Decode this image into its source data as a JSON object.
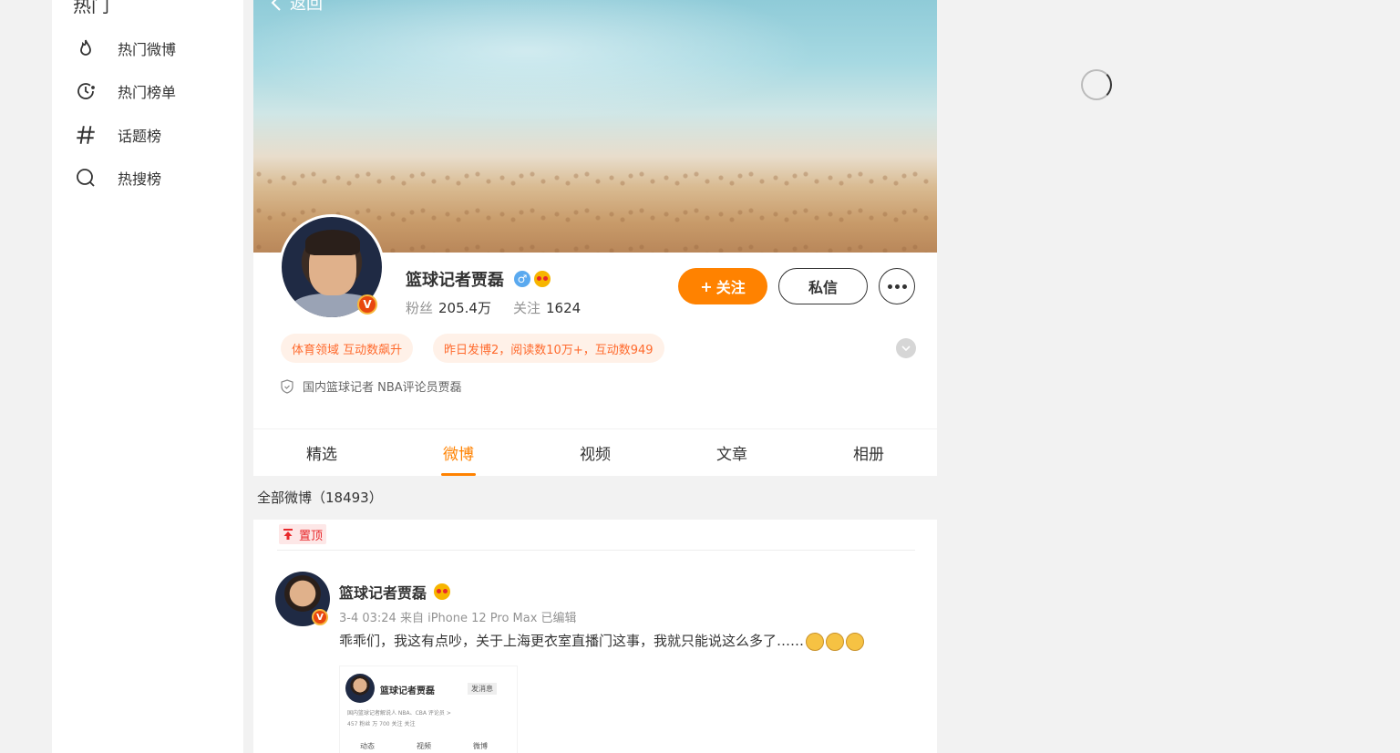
{
  "sidebar": {
    "section_title": "热门",
    "items": [
      {
        "label": "热门微博",
        "icon": "flame-icon"
      },
      {
        "label": "热门榜单",
        "icon": "clock-icon"
      },
      {
        "label": "话题榜",
        "icon": "hashtag-icon"
      },
      {
        "label": "热搜榜",
        "icon": "search-icon"
      }
    ]
  },
  "header": {
    "back_label": "返回"
  },
  "profile": {
    "screen_name": "篮球记者贾磊",
    "verified_mark": "V",
    "fans_label": "粉丝",
    "fans_count": "205.4万",
    "following_label": "关注",
    "following_count": "1624",
    "follow_button": "关注",
    "message_button": "私信",
    "tags": [
      "体育领域 互动数飙升",
      "昨日发博2，阅读数10万+，互动数949"
    ],
    "bio": "国内篮球记者 NBA评论员贾磊"
  },
  "tabs": [
    {
      "label": "精选",
      "active": false
    },
    {
      "label": "微博",
      "active": true
    },
    {
      "label": "视频",
      "active": false
    },
    {
      "label": "文章",
      "active": false
    },
    {
      "label": "相册",
      "active": false
    }
  ],
  "feed": {
    "count_label": "全部微博（18493）",
    "pinned_label": "置顶",
    "post": {
      "author": "篮球记者贾磊",
      "meta": "3-4 03:24  来自 iPhone 12 Pro Max 已编辑",
      "text": "乖乖们，我这有点吵，关于上海更衣室直播门这事，我就只能说这么多了……",
      "image_preview": {
        "name": "篮球记者贾磊",
        "action": "发消息",
        "line1": "国内篮球记者解说人 NBA、CBA 评论员 >",
        "line2": "457 粉丝 万 700 关注 关注",
        "tab1": "动态",
        "tab2": "视频",
        "tab3": "微博"
      }
    }
  },
  "colors": {
    "accent": "#ff8200",
    "tag_bg": "#fff1e8",
    "tag_text": "#ff6a2d"
  }
}
